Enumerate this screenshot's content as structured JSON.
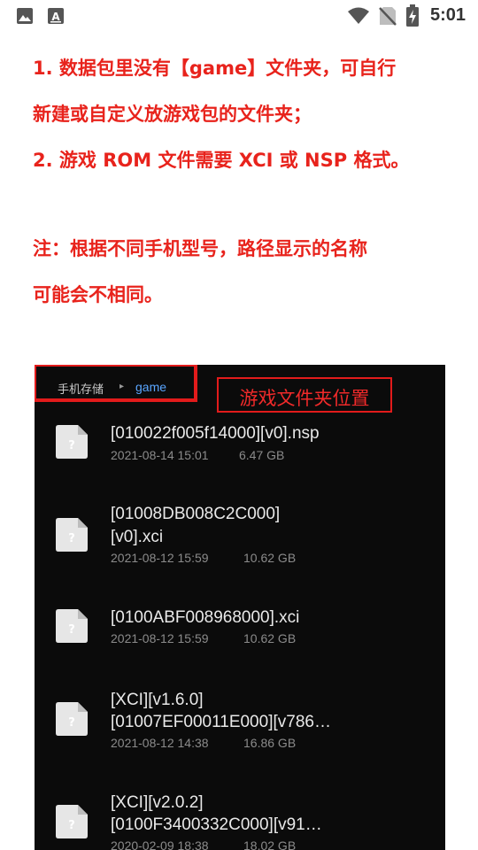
{
  "status_bar": {
    "time": "5:01",
    "icons": [
      "image-icon",
      "text-a-icon",
      "wifi-icon",
      "no-sim-icon",
      "battery-charging-icon"
    ]
  },
  "instructions": {
    "line1": "1. 数据包里没有【game】文件夹，可自行",
    "line2": "新建或自定义放游戏包的文件夹；",
    "line3": "2. 游戏 ROM 文件需要 XCI 或 NSP 格式。",
    "note_line1": "注：根据不同手机型号，路径显示的名称",
    "note_line2": "可能会不相同。"
  },
  "file_browser": {
    "breadcrumb_root": "手机存储",
    "breadcrumb_separator": "▸",
    "breadcrumb_current": "game",
    "annotation_label": "游戏文件夹位置",
    "files": [
      {
        "name_line1": "[010022f005f14000][v0].nsp",
        "name_line2": "",
        "date": "2021-08-14 15:01",
        "size": "6.47 GB"
      },
      {
        "name_line1": "[01008DB008C2C000]",
        "name_line2": "[v0].xci",
        "date": "2021-08-12 15:59",
        "size": "10.62 GB"
      },
      {
        "name_line1": "[0100ABF008968000].xci",
        "name_line2": "",
        "date": "2021-08-12 15:59",
        "size": "10.62 GB"
      },
      {
        "name_line1": "[XCI][v1.6.0]",
        "name_line2": "[01007EF00011E000][v786…",
        "date": "2021-08-12 14:38",
        "size": "16.86 GB"
      },
      {
        "name_line1": "[XCI][v2.0.2]",
        "name_line2": "[0100F3400332C000][v91…",
        "date": "2020-02-09 18:38",
        "size": "18.02 GB"
      }
    ]
  }
}
